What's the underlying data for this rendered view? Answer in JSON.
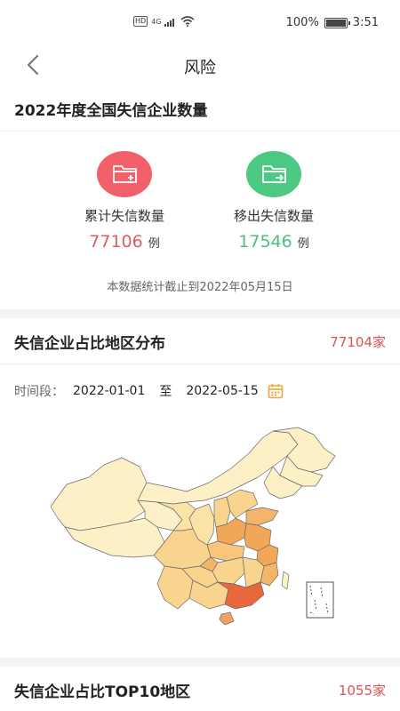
{
  "status": {
    "network": "4G",
    "hd": "HD",
    "battery": "100%",
    "time": "3:51"
  },
  "nav": {
    "title": "风险"
  },
  "summary": {
    "title": "2022年度全国失信企业数量",
    "cumulative": {
      "label": "累计失信数量",
      "value": "77106",
      "unit": "例",
      "color": "#e05d5d"
    },
    "removed": {
      "label": "移出失信数量",
      "value": "17546",
      "unit": "例",
      "color": "#4cbf7e"
    },
    "note": "本数据统计截止到2022年05月15日"
  },
  "distribution": {
    "title": "失信企业占比地区分布",
    "count": "77104家",
    "date_label": "时间段：",
    "start_date": "2022-01-01",
    "separator": "至",
    "end_date": "2022-05-15"
  },
  "top10": {
    "title": "失信企业占比TOP10地区",
    "count": "1055家"
  },
  "icons": {
    "back": "back-arrow-icon",
    "calendar": "calendar-icon",
    "folder_add": "folder-add-icon",
    "folder_out": "folder-export-icon"
  },
  "colors": {
    "accent_red": "#e05050",
    "map_light": "#fdf0c6",
    "map_mid": "#f8d48f",
    "map_high": "#f2a657",
    "map_top": "#e8673c"
  }
}
